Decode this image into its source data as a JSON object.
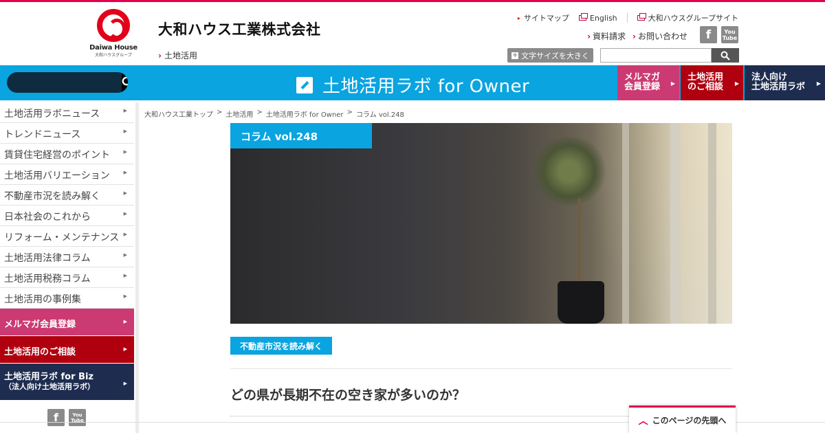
{
  "header": {
    "logo_brand": "Daiwa House",
    "logo_sub": "大和ハウスグループ",
    "corp_name": "大和ハウス工業株式会社",
    "section": "土地活用",
    "util_links": {
      "sitemap": "サイトマップ",
      "english": "English",
      "group": "大和ハウスグループサイト"
    },
    "actions": {
      "request": "資料請求",
      "contact": "お問い合わせ"
    },
    "fontsize_label": "文字サイズを大きく",
    "search_value": "",
    "social": {
      "fb": "f",
      "yt_top": "You",
      "yt_bottom": "Tube"
    }
  },
  "band": {
    "search_value": "",
    "title": "土地活用ラボ for Owner",
    "btn_mail_line1": "メルマガ",
    "btn_mail_line2": "会員登録",
    "btn_consult_line1": "土地活用",
    "btn_consult_line2": "のご相談",
    "btn_corp_line1": "法人向け",
    "btn_corp_line2": "土地活用ラボ"
  },
  "sidebar": {
    "items": [
      "土地活用ラボニュース",
      "トレンドニュース",
      "賃貸住宅経営のポイント",
      "土地活用バリエーション",
      "不動産市況を読み解く",
      "日本社会のこれから",
      "リフォーム・メンテナンス",
      "土地活用法律コラム",
      "土地活用税務コラム",
      "土地活用の事例集"
    ],
    "mail": "メルマガ会員登録",
    "consult": "土地活用のご相談",
    "biz_title": "土地活用ラボ for Biz",
    "biz_sub": "（法人向け土地活用ラボ）"
  },
  "breadcrumb": [
    "大和ハウス工業トップ",
    "土地活用",
    "土地活用ラボ for Owner",
    "コラム vol.248"
  ],
  "breadcrumb_sep": ">",
  "article": {
    "hero_label": "コラム vol.248",
    "category": "不動産市況を読み解く",
    "headline": "どの県が長期不在の空き家が多いのか？"
  },
  "pagetop": "このページの先頭へ",
  "colors": {
    "accent_red": "#e2004f",
    "band_blue": "#0aa4e0",
    "pink": "#cc3a73",
    "dark_red": "#b0000f",
    "navy": "#1e2d4f"
  },
  "icons": [
    "search-icon",
    "pencil-icon",
    "external-window-icon",
    "facebook-icon",
    "youtube-icon",
    "chevron-up-icon"
  ]
}
